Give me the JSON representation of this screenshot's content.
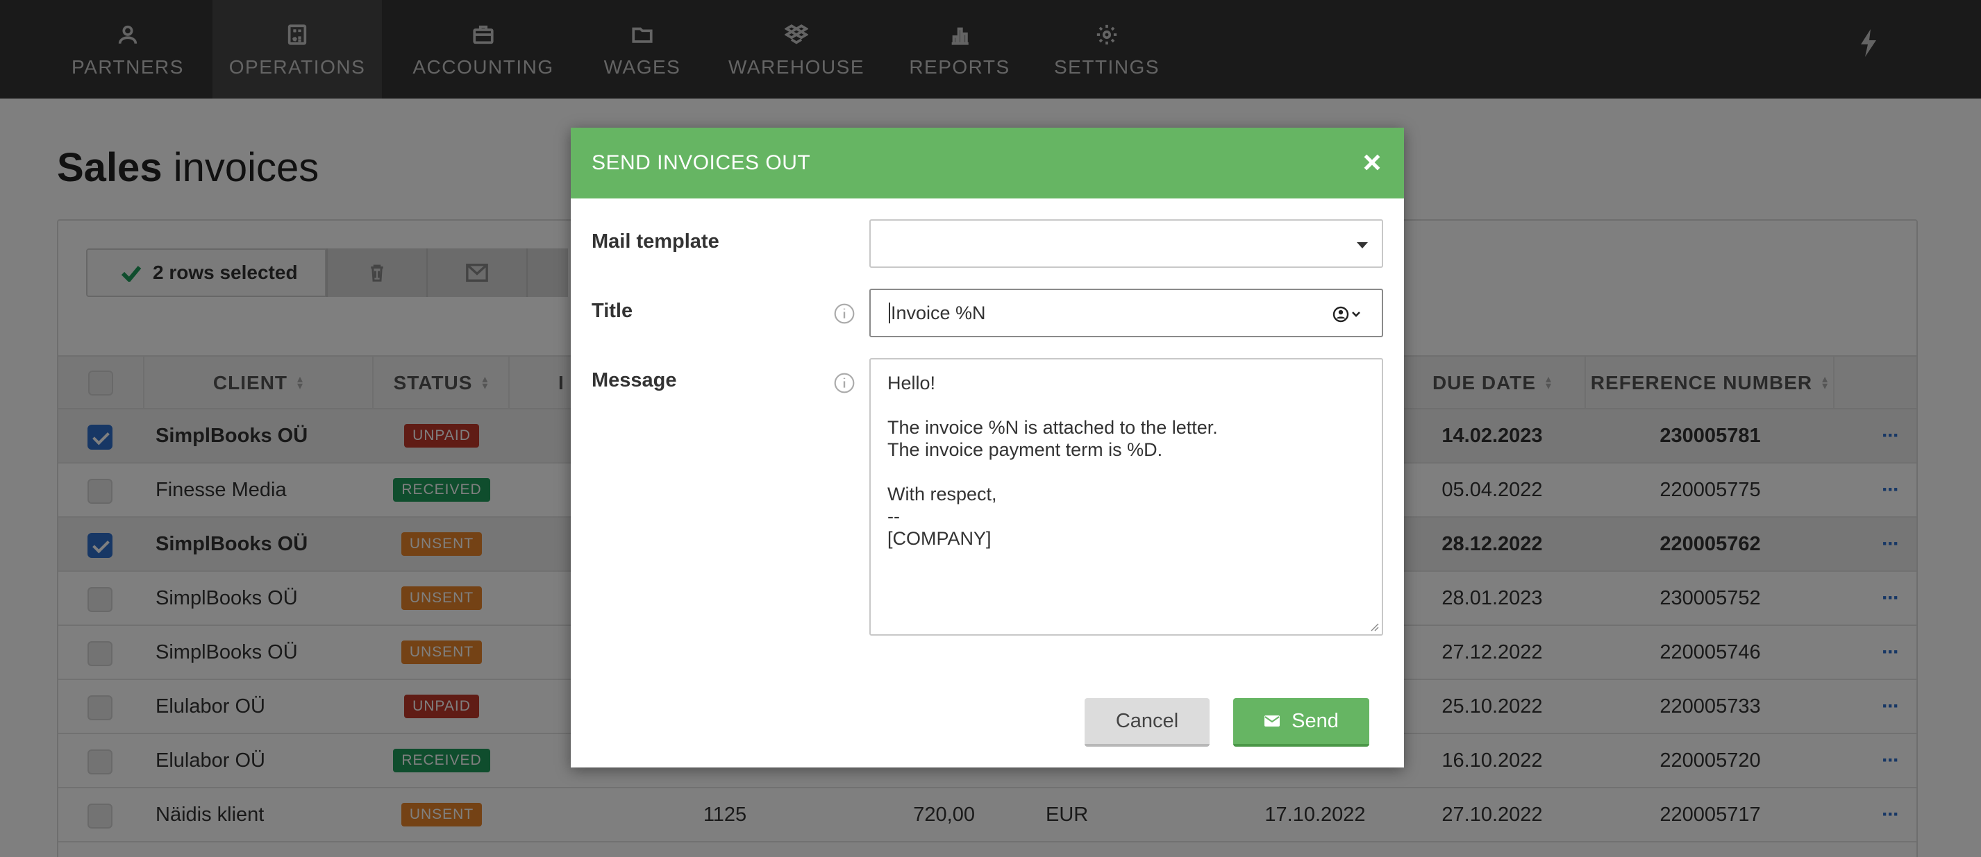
{
  "nav": {
    "items": [
      {
        "label": "PARTNERS",
        "icon": "person-icon"
      },
      {
        "label": "OPERATIONS",
        "icon": "calculator-icon"
      },
      {
        "label": "ACCOUNTING",
        "icon": "briefcase-icon"
      },
      {
        "label": "WAGES",
        "icon": "folder-icon"
      },
      {
        "label": "WAREHOUSE",
        "icon": "dropbox-icon"
      },
      {
        "label": "REPORTS",
        "icon": "bar-chart-icon"
      },
      {
        "label": "SETTINGS",
        "icon": "gear-icon"
      }
    ],
    "active": "OPERATIONS"
  },
  "page": {
    "title_bold": "Sales",
    "title_light": "invoices"
  },
  "toolbar": {
    "selection_text": "2 rows selected"
  },
  "table": {
    "columns": [
      "CLIENT",
      "STATUS",
      "I",
      "DUE DATE",
      "REFERENCE NUMBER"
    ],
    "rows": [
      {
        "selected": true,
        "client": "SimplBooks OÜ",
        "status": "UNPAID",
        "status_type": "unpaid",
        "number": "",
        "sum": "",
        "currency": "",
        "date": "",
        "due_date": "14.02.2023",
        "reference": "230005781"
      },
      {
        "selected": false,
        "client": "Finesse Media",
        "status": "RECEIVED",
        "status_type": "received",
        "number": "",
        "sum": "",
        "currency": "",
        "date": "",
        "due_date": "05.04.2022",
        "reference": "220005775"
      },
      {
        "selected": true,
        "client": "SimplBooks OÜ",
        "status": "UNSENT",
        "status_type": "unsent",
        "number": "",
        "sum": "",
        "currency": "",
        "date": "",
        "due_date": "28.12.2022",
        "reference": "220005762"
      },
      {
        "selected": false,
        "client": "SimplBooks OÜ",
        "status": "UNSENT",
        "status_type": "unsent",
        "number": "",
        "sum": "",
        "currency": "",
        "date": "",
        "due_date": "28.01.2023",
        "reference": "230005752"
      },
      {
        "selected": false,
        "client": "SimplBooks OÜ",
        "status": "UNSENT",
        "status_type": "unsent",
        "number": "",
        "sum": "",
        "currency": "",
        "date": "",
        "due_date": "27.12.2022",
        "reference": "220005746"
      },
      {
        "selected": false,
        "client": "Elulabor OÜ",
        "status": "UNPAID",
        "status_type": "unpaid",
        "number": "",
        "sum": "",
        "currency": "",
        "date": "",
        "due_date": "25.10.2022",
        "reference": "220005733"
      },
      {
        "selected": false,
        "client": "Elulabor OÜ",
        "status": "RECEIVED",
        "status_type": "received",
        "number": "",
        "sum": "",
        "currency": "",
        "date": "",
        "due_date": "16.10.2022",
        "reference": "220005720"
      },
      {
        "selected": false,
        "client": "Näidis klient",
        "status": "UNSENT",
        "status_type": "unsent",
        "number": "1125",
        "sum": "720,00",
        "currency": "EUR",
        "date": "17.10.2022",
        "due_date": "27.10.2022",
        "reference": "220005717"
      }
    ]
  },
  "modal": {
    "title": "SEND INVOICES OUT",
    "mail_template_label": "Mail template",
    "mail_template_value": "",
    "title_label": "Title",
    "title_value": "Invoice %N",
    "message_label": "Message",
    "message_value": "Hello!\n\nThe invoice %N is attached to the letter.\nThe invoice payment term is %D.\n\nWith respect,\n--\n[COMPANY]",
    "cancel_label": "Cancel",
    "send_label": "Send"
  },
  "colors": {
    "nav_bg": "#353535",
    "modal_header": "#66b563",
    "checkbox_on": "#2e6ecb",
    "unpaid": "#c0392b",
    "received": "#1e9b5a",
    "unsent": "#e8852a"
  }
}
